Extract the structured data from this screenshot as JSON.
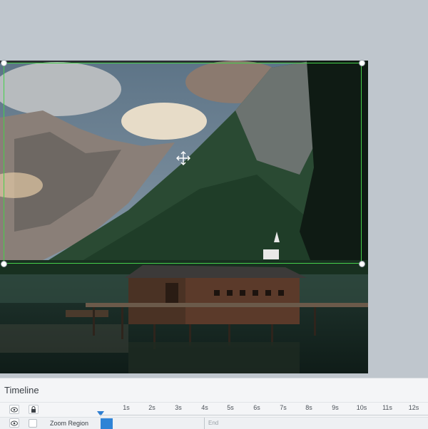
{
  "timeline": {
    "title": "Timeline",
    "ruler_ticks": [
      "1s",
      "2s",
      "3s",
      "4s",
      "5s",
      "6s",
      "7s",
      "8s",
      "9s",
      "10s",
      "11s",
      "12s"
    ],
    "track": {
      "label": "Zoom Region",
      "end_label": "End"
    }
  },
  "colors": {
    "selection_border": "#45d04a",
    "track_block": "#2f83d6",
    "playhead": "#2f7fd1",
    "canvas_background": "#bfc6cd"
  },
  "icons": {
    "visibility": "eye-icon",
    "lock": "lock-icon",
    "move_cursor": "move-cursor-icon"
  }
}
